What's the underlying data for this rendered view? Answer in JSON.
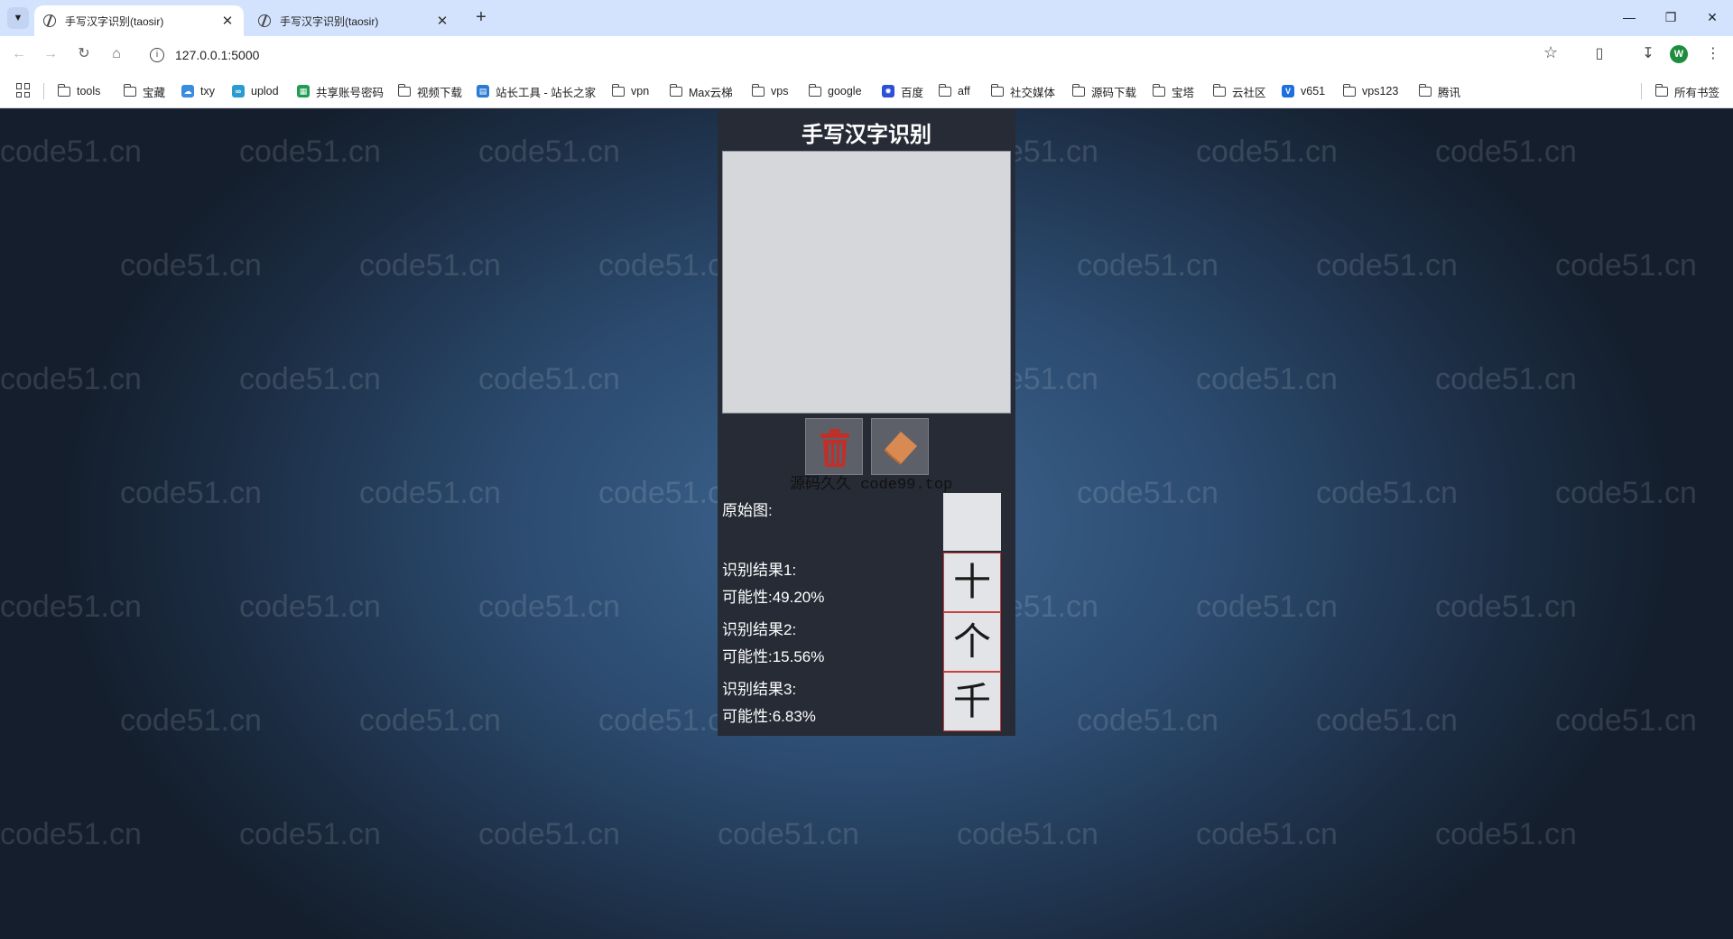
{
  "browser": {
    "tabs": [
      {
        "title": "手写汉字识别(taosir)",
        "active": true
      },
      {
        "title": "手写汉字识别(taosir)",
        "active": false
      }
    ],
    "url": "127.0.0.1:5000",
    "profile_initial": "W",
    "bookmarks": [
      {
        "label": "tools",
        "icon": "folder-icon"
      },
      {
        "label": "宝藏",
        "icon": "folder-icon"
      },
      {
        "label": "txy",
        "icon": "cloud-icon"
      },
      {
        "label": "uplod",
        "icon": "link-icon"
      },
      {
        "label": "共享账号密码",
        "icon": "sheet-icon"
      },
      {
        "label": "视频下载",
        "icon": "folder-icon"
      },
      {
        "label": "站长工具 - 站长之家",
        "icon": "chart-icon"
      },
      {
        "label": "vpn",
        "icon": "folder-icon"
      },
      {
        "label": "Max云梯",
        "icon": "folder-icon"
      },
      {
        "label": "vps",
        "icon": "folder-icon"
      },
      {
        "label": "google",
        "icon": "folder-icon"
      },
      {
        "label": "百度",
        "icon": "baidu-icon"
      },
      {
        "label": "aff",
        "icon": "folder-icon"
      },
      {
        "label": "社交媒体",
        "icon": "folder-icon"
      },
      {
        "label": "源码下载",
        "icon": "folder-icon"
      },
      {
        "label": "宝塔",
        "icon": "folder-icon"
      },
      {
        "label": "云社区",
        "icon": "folder-icon"
      },
      {
        "label": "v651",
        "icon": "v-icon"
      },
      {
        "label": "vps123",
        "icon": "folder-icon"
      },
      {
        "label": "腾讯",
        "icon": "folder-icon"
      }
    ],
    "all_bookmarks": "所有书签"
  },
  "app": {
    "title": "手写汉字识别",
    "credit": "源码久久 code99.top",
    "original_label": "原始图:",
    "results": [
      {
        "label": "识别结果1:",
        "probability": "可能性:49.20%",
        "char": "十"
      },
      {
        "label": "识别结果2:",
        "probability": "可能性:15.56%",
        "char": "个"
      },
      {
        "label": "识别结果3:",
        "probability": "可能性:6.83%",
        "char": "千"
      }
    ],
    "tools": [
      "trash-icon",
      "eraser-icon"
    ]
  },
  "watermark": "code51.cn",
  "colors": {
    "tabbar": "#d3e3fd",
    "panel": "#262b35",
    "canvas": "#d5d7da",
    "trash": "#c0302a",
    "eraser": "#d88a52",
    "result_border": "#c94040"
  }
}
